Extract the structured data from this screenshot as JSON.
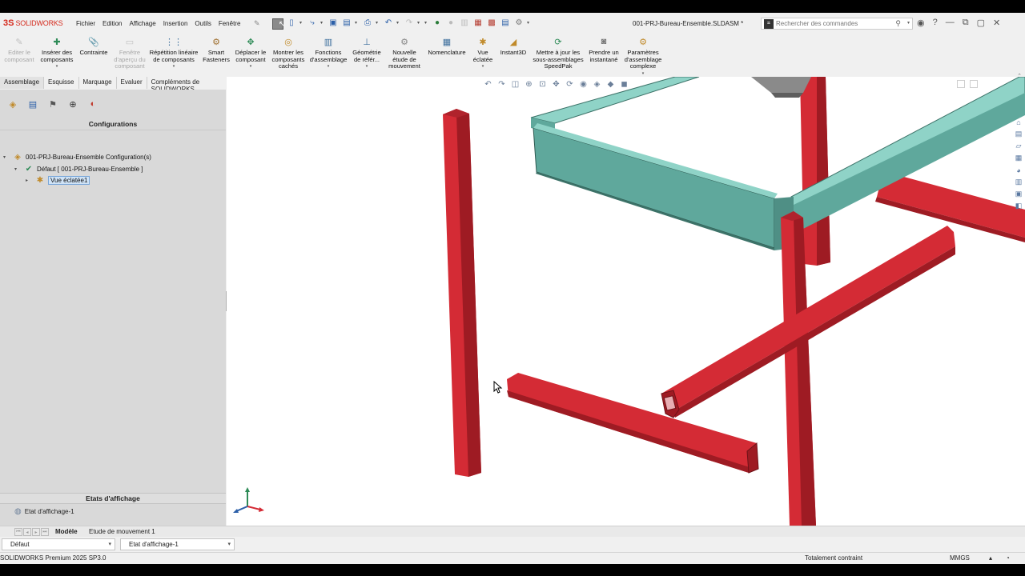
{
  "app": {
    "logo_mark": "3S",
    "logo_text": "SOLIDWORKS",
    "document_title": "001-PRJ-Bureau-Ensemble.SLDASM *",
    "brand_color": "#d52b1e"
  },
  "menu": {
    "items": [
      "Fichier",
      "Edition",
      "Affichage",
      "Insertion",
      "Outils",
      "Fenêtre"
    ]
  },
  "search": {
    "placeholder": "Rechercher des commandes"
  },
  "ribbon": {
    "buttons": [
      {
        "label": "Editer le composant",
        "icon": "edit-component-icon",
        "disabled": true
      },
      {
        "label": "Insérer des composants",
        "icon": "insert-components-icon",
        "disabled": false
      },
      {
        "label": "Contrainte",
        "icon": "mate-icon",
        "disabled": false
      },
      {
        "label": "Fenêtre d'aperçu du composant",
        "icon": "component-preview-icon",
        "disabled": true
      },
      {
        "label": "Répétition linéaire de composants",
        "icon": "linear-pattern-icon",
        "disabled": false
      },
      {
        "label": "Smart Fasteners",
        "icon": "smart-fasteners-icon",
        "disabled": false
      },
      {
        "label": "Déplacer le composant",
        "icon": "move-component-icon",
        "disabled": false
      },
      {
        "label": "Montrer les composants cachés",
        "icon": "show-hidden-icon",
        "disabled": false
      },
      {
        "label": "Fonctions d'assemblage",
        "icon": "assembly-features-icon",
        "disabled": false
      },
      {
        "label": "Géométrie de référ...",
        "icon": "reference-geometry-icon",
        "disabled": false
      },
      {
        "label": "Nouvelle étude de mouvement",
        "icon": "motion-study-icon",
        "disabled": false
      },
      {
        "label": "Nomenclature",
        "icon": "bom-icon",
        "disabled": false
      },
      {
        "label": "Vue éclatée",
        "icon": "exploded-view-icon",
        "disabled": false
      },
      {
        "label": "Instant3D",
        "icon": "instant3d-icon",
        "disabled": false
      },
      {
        "label": "Mettre à jour les sous-assemblages SpeedPak",
        "icon": "speedpak-icon",
        "disabled": false
      },
      {
        "label": "Prendre un instantané",
        "icon": "snapshot-icon",
        "disabled": false
      },
      {
        "label": "Paramètres d'assemblage complexe",
        "icon": "large-assembly-icon",
        "disabled": false
      }
    ]
  },
  "command_tabs": [
    "Assemblage",
    "Esquisse",
    "Marquage",
    "Evaluer",
    "Compléments de SOLIDWORKS"
  ],
  "left_panel": {
    "title": "Configurations",
    "tree": [
      {
        "label": "001-PRJ-Bureau-Ensemble Configuration(s)",
        "icon": "assembly-config-icon"
      },
      {
        "label": "Défaut [ 001-PRJ-Bureau-Ensemble ]",
        "icon": "config-check-icon"
      },
      {
        "label": "Vue éclatée1",
        "icon": "exploded-view-icon"
      }
    ],
    "display_states_title": "Etats d'affichage",
    "display_state": "Etat d'affichage-1"
  },
  "bottom_tabs": [
    "Modèle",
    "Etude de mouvement 1"
  ],
  "config_selectors": {
    "configuration": "Défaut",
    "display_state": "Etat d'affichage-1"
  },
  "status": {
    "product": "SOLIDWORKS Premium 2025 SP3.0",
    "constraint": "Totalement contraint",
    "units": "MMGS"
  },
  "model_colors": {
    "tube": "#d42b35",
    "tube_dark": "#9e1b23",
    "frame": "#5fa89c",
    "frame_light": "#8fd3c7",
    "frame_dark": "#3c7268"
  }
}
